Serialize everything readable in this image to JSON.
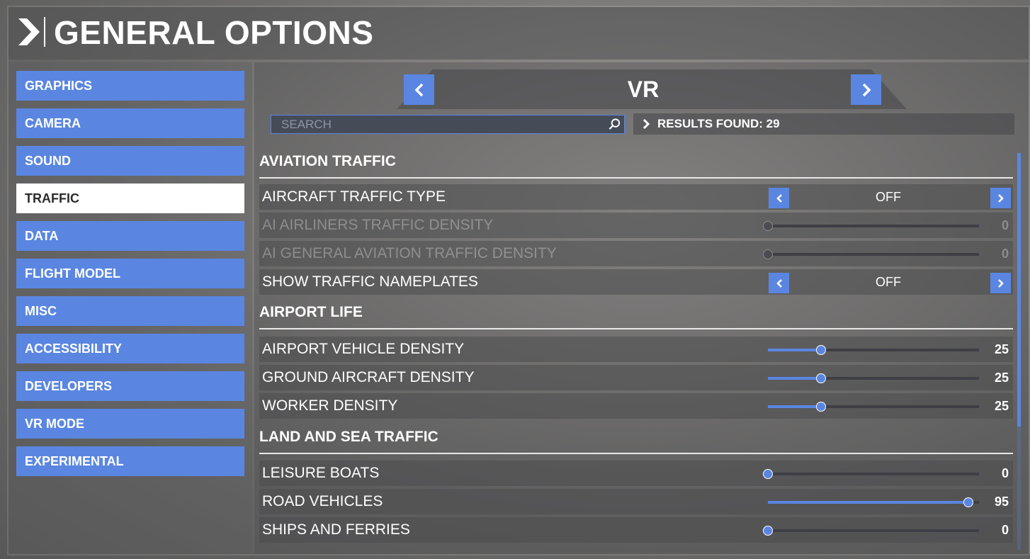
{
  "header": {
    "title": "GENERAL OPTIONS"
  },
  "sidebar": {
    "items": [
      {
        "label": "GRAPHICS"
      },
      {
        "label": "CAMERA"
      },
      {
        "label": "SOUND"
      },
      {
        "label": "TRAFFIC",
        "active": true
      },
      {
        "label": "DATA"
      },
      {
        "label": "FLIGHT MODEL"
      },
      {
        "label": "MISC"
      },
      {
        "label": "ACCESSIBILITY"
      },
      {
        "label": "DEVELOPERS"
      },
      {
        "label": "VR MODE"
      },
      {
        "label": "EXPERIMENTAL"
      }
    ]
  },
  "preset": {
    "name": "VR"
  },
  "search": {
    "placeholder": "SEARCH",
    "value": ""
  },
  "results": {
    "text": "RESULTS FOUND: 29"
  },
  "sections": [
    {
      "title": "AVIATION TRAFFIC",
      "rows": [
        {
          "label": "AIRCRAFT TRAFFIC TYPE",
          "type": "toggle",
          "value": "OFF",
          "enabled": true
        },
        {
          "label": "AI AIRLINERS TRAFFIC DENSITY",
          "type": "slider",
          "value": "0",
          "level": 0,
          "enabled": false
        },
        {
          "label": "AI GENERAL AVIATION TRAFFIC DENSITY",
          "type": "slider",
          "value": "0",
          "level": 0,
          "enabled": false
        },
        {
          "label": "SHOW TRAFFIC NAMEPLATES",
          "type": "toggle",
          "value": "OFF",
          "enabled": true
        }
      ]
    },
    {
      "title": "AIRPORT LIFE",
      "rows": [
        {
          "label": "AIRPORT VEHICLE DENSITY",
          "type": "slider",
          "value": "25",
          "level": 25,
          "enabled": true
        },
        {
          "label": "GROUND AIRCRAFT DENSITY",
          "type": "slider",
          "value": "25",
          "level": 25,
          "enabled": true
        },
        {
          "label": "WORKER DENSITY",
          "type": "slider",
          "value": "25",
          "level": 25,
          "enabled": true
        }
      ]
    },
    {
      "title": "LAND AND SEA TRAFFIC",
      "rows": [
        {
          "label": "LEISURE BOATS",
          "type": "slider",
          "value": "0",
          "level": 0,
          "enabled": true
        },
        {
          "label": "ROAD VEHICLES",
          "type": "slider",
          "value": "95",
          "level": 95,
          "enabled": true
        },
        {
          "label": "SHIPS AND FERRIES",
          "type": "slider",
          "value": "0",
          "level": 0,
          "enabled": true
        }
      ]
    }
  ],
  "icons": {
    "logo": "chevron-right-icon",
    "prev": "chevron-left-icon",
    "next": "chevron-right-icon",
    "search": "search-icon"
  },
  "colors": {
    "accent": "#5a86e1",
    "active_bg": "#ffffff",
    "active_text": "#2b2b2b"
  }
}
